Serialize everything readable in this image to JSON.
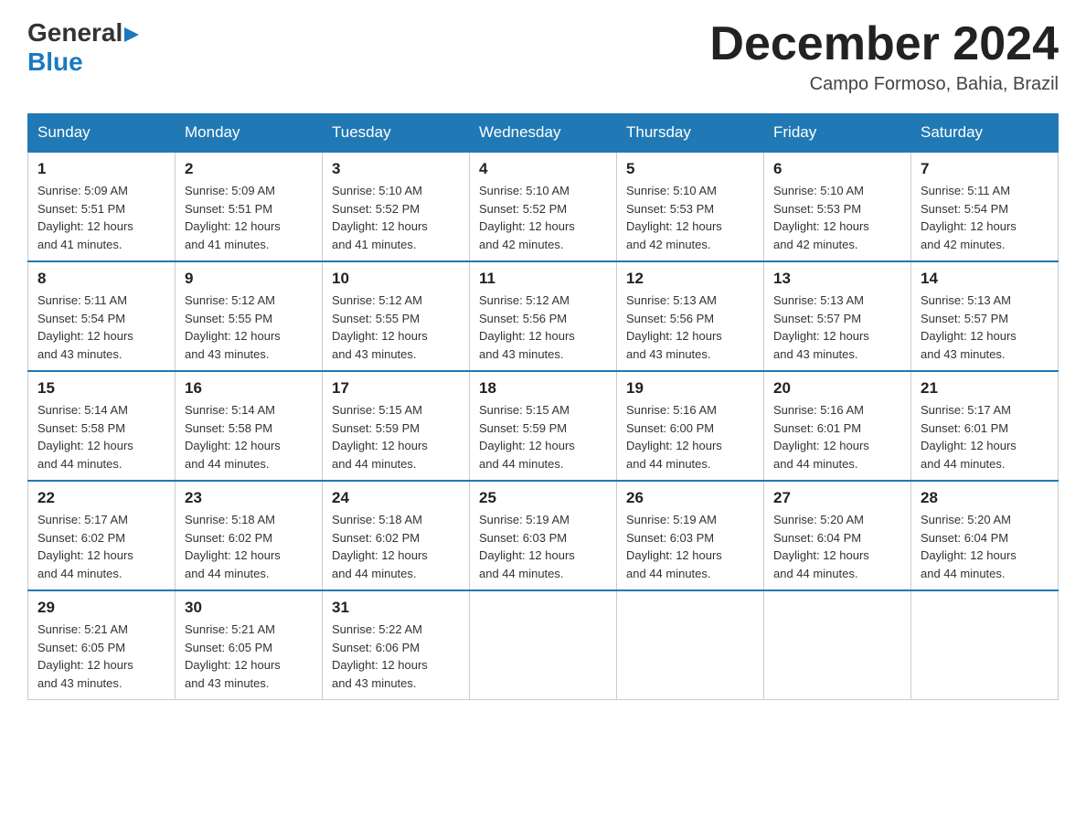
{
  "header": {
    "logo_general": "General",
    "logo_blue": "Blue",
    "month_title": "December 2024",
    "location": "Campo Formoso, Bahia, Brazil"
  },
  "days_of_week": [
    "Sunday",
    "Monday",
    "Tuesday",
    "Wednesday",
    "Thursday",
    "Friday",
    "Saturday"
  ],
  "weeks": [
    [
      {
        "day": "1",
        "sunrise": "5:09 AM",
        "sunset": "5:51 PM",
        "daylight": "12 hours and 41 minutes."
      },
      {
        "day": "2",
        "sunrise": "5:09 AM",
        "sunset": "5:51 PM",
        "daylight": "12 hours and 41 minutes."
      },
      {
        "day": "3",
        "sunrise": "5:10 AM",
        "sunset": "5:52 PM",
        "daylight": "12 hours and 41 minutes."
      },
      {
        "day": "4",
        "sunrise": "5:10 AM",
        "sunset": "5:52 PM",
        "daylight": "12 hours and 42 minutes."
      },
      {
        "day": "5",
        "sunrise": "5:10 AM",
        "sunset": "5:53 PM",
        "daylight": "12 hours and 42 minutes."
      },
      {
        "day": "6",
        "sunrise": "5:10 AM",
        "sunset": "5:53 PM",
        "daylight": "12 hours and 42 minutes."
      },
      {
        "day": "7",
        "sunrise": "5:11 AM",
        "sunset": "5:54 PM",
        "daylight": "12 hours and 42 minutes."
      }
    ],
    [
      {
        "day": "8",
        "sunrise": "5:11 AM",
        "sunset": "5:54 PM",
        "daylight": "12 hours and 43 minutes."
      },
      {
        "day": "9",
        "sunrise": "5:12 AM",
        "sunset": "5:55 PM",
        "daylight": "12 hours and 43 minutes."
      },
      {
        "day": "10",
        "sunrise": "5:12 AM",
        "sunset": "5:55 PM",
        "daylight": "12 hours and 43 minutes."
      },
      {
        "day": "11",
        "sunrise": "5:12 AM",
        "sunset": "5:56 PM",
        "daylight": "12 hours and 43 minutes."
      },
      {
        "day": "12",
        "sunrise": "5:13 AM",
        "sunset": "5:56 PM",
        "daylight": "12 hours and 43 minutes."
      },
      {
        "day": "13",
        "sunrise": "5:13 AM",
        "sunset": "5:57 PM",
        "daylight": "12 hours and 43 minutes."
      },
      {
        "day": "14",
        "sunrise": "5:13 AM",
        "sunset": "5:57 PM",
        "daylight": "12 hours and 43 minutes."
      }
    ],
    [
      {
        "day": "15",
        "sunrise": "5:14 AM",
        "sunset": "5:58 PM",
        "daylight": "12 hours and 44 minutes."
      },
      {
        "day": "16",
        "sunrise": "5:14 AM",
        "sunset": "5:58 PM",
        "daylight": "12 hours and 44 minutes."
      },
      {
        "day": "17",
        "sunrise": "5:15 AM",
        "sunset": "5:59 PM",
        "daylight": "12 hours and 44 minutes."
      },
      {
        "day": "18",
        "sunrise": "5:15 AM",
        "sunset": "5:59 PM",
        "daylight": "12 hours and 44 minutes."
      },
      {
        "day": "19",
        "sunrise": "5:16 AM",
        "sunset": "6:00 PM",
        "daylight": "12 hours and 44 minutes."
      },
      {
        "day": "20",
        "sunrise": "5:16 AM",
        "sunset": "6:01 PM",
        "daylight": "12 hours and 44 minutes."
      },
      {
        "day": "21",
        "sunrise": "5:17 AM",
        "sunset": "6:01 PM",
        "daylight": "12 hours and 44 minutes."
      }
    ],
    [
      {
        "day": "22",
        "sunrise": "5:17 AM",
        "sunset": "6:02 PM",
        "daylight": "12 hours and 44 minutes."
      },
      {
        "day": "23",
        "sunrise": "5:18 AM",
        "sunset": "6:02 PM",
        "daylight": "12 hours and 44 minutes."
      },
      {
        "day": "24",
        "sunrise": "5:18 AM",
        "sunset": "6:02 PM",
        "daylight": "12 hours and 44 minutes."
      },
      {
        "day": "25",
        "sunrise": "5:19 AM",
        "sunset": "6:03 PM",
        "daylight": "12 hours and 44 minutes."
      },
      {
        "day": "26",
        "sunrise": "5:19 AM",
        "sunset": "6:03 PM",
        "daylight": "12 hours and 44 minutes."
      },
      {
        "day": "27",
        "sunrise": "5:20 AM",
        "sunset": "6:04 PM",
        "daylight": "12 hours and 44 minutes."
      },
      {
        "day": "28",
        "sunrise": "5:20 AM",
        "sunset": "6:04 PM",
        "daylight": "12 hours and 44 minutes."
      }
    ],
    [
      {
        "day": "29",
        "sunrise": "5:21 AM",
        "sunset": "6:05 PM",
        "daylight": "12 hours and 43 minutes."
      },
      {
        "day": "30",
        "sunrise": "5:21 AM",
        "sunset": "6:05 PM",
        "daylight": "12 hours and 43 minutes."
      },
      {
        "day": "31",
        "sunrise": "5:22 AM",
        "sunset": "6:06 PM",
        "daylight": "12 hours and 43 minutes."
      },
      null,
      null,
      null,
      null
    ]
  ],
  "labels": {
    "sunrise": "Sunrise:",
    "sunset": "Sunset:",
    "daylight": "Daylight:"
  }
}
